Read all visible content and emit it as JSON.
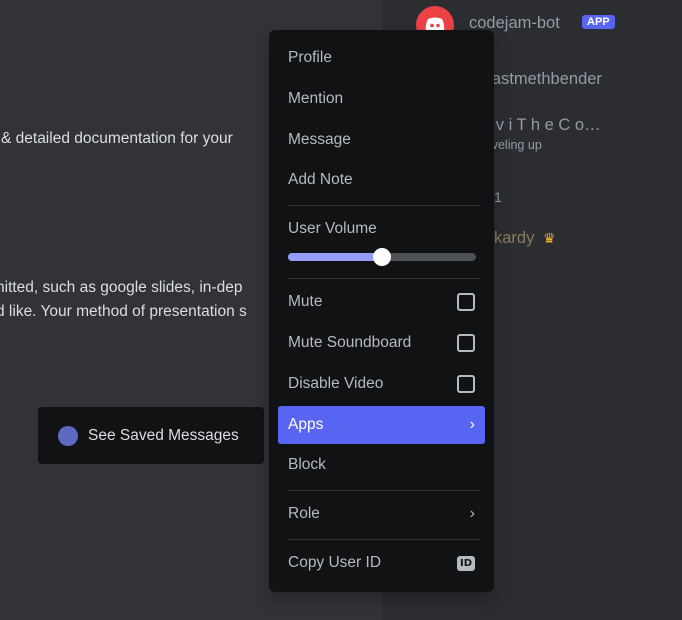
{
  "chat": {
    "line1": "& detailed documentation for your",
    "line2": "nitted, such as google slides, in-dep",
    "line3": "d like. Your method of presentation s"
  },
  "saved_messages": {
    "label": "See Saved Messages"
  },
  "members": {
    "bot_name": "codejam-bot",
    "bot_badge": "APP",
    "member2": "elastmethbender",
    "member3": "a v i T h e C o…",
    "member3_status": "leveling up",
    "member4": "1",
    "member5": "kardy"
  },
  "menu": {
    "profile": "Profile",
    "mention": "Mention",
    "message": "Message",
    "add_note": "Add Note",
    "user_volume": "User Volume",
    "volume_fraction": 0.5,
    "mute": "Mute",
    "mute_soundboard": "Mute Soundboard",
    "disable_video": "Disable Video",
    "apps": "Apps",
    "block": "Block",
    "role": "Role",
    "copy_user_id": "Copy User ID",
    "id_icon_text": "ID"
  },
  "colors": {
    "accent": "#5865f2",
    "menu_bg": "#111214",
    "slider_fill": "#949cf7",
    "bot_avatar": "#ed4245"
  }
}
